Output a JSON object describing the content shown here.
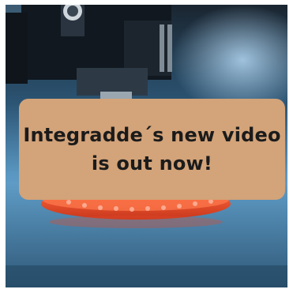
{
  "announcement": {
    "line1": "Integradde´s new video",
    "line2": "is out now!"
  },
  "photo": {
    "subject": "3D printer nozzle printing an orange object",
    "colors": {
      "card": "#d3a379",
      "text": "#1b1b1b",
      "print": "#e04a2a",
      "background_blue": "#4d86ad"
    }
  }
}
